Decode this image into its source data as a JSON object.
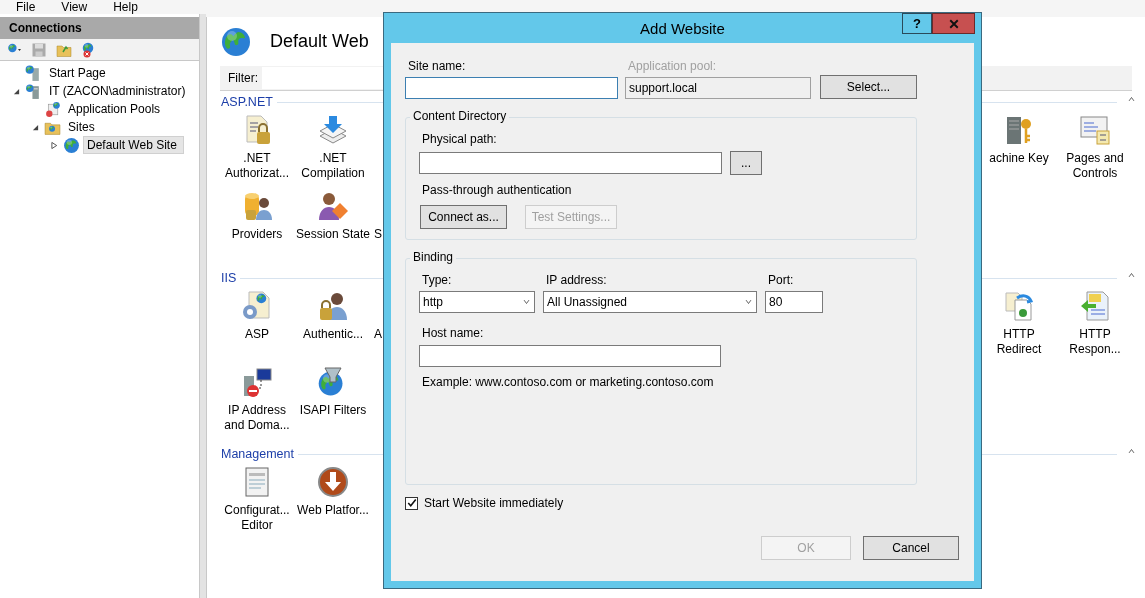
{
  "menu": [
    "File",
    "View",
    "Help"
  ],
  "connections": {
    "title": "Connections",
    "tree": [
      {
        "label": "Start Page",
        "selected": false
      },
      {
        "label": "IT (ZACON\\administrator)",
        "selected": false,
        "expanded": true,
        "children": [
          {
            "label": "Application Pools",
            "selected": false
          },
          {
            "label": "Sites",
            "selected": false,
            "expanded": true,
            "children": [
              {
                "label": "Default Web Site",
                "selected": true,
                "expanded": false
              }
            ]
          }
        ]
      }
    ]
  },
  "main": {
    "title": "Default Web",
    "filter_label": "Filter:",
    "sections": [
      {
        "title": "ASP.NET",
        "rows": [
          {
            "left": [
              {
                "label": ".NET Authorizat..."
              },
              {
                "label": ".NET Compilation"
              }
            ],
            "right": [
              {
                "label": "achine Key"
              },
              {
                "label": "Pages and Controls"
              }
            ]
          },
          {
            "left": [
              {
                "label": "Providers"
              },
              {
                "label": "Session State"
              },
              {
                "label": "S",
                "kind": "cut"
              }
            ]
          }
        ]
      },
      {
        "title": "IIS",
        "rows": [
          {
            "left": [
              {
                "label": "ASP"
              },
              {
                "label": "Authentic..."
              },
              {
                "label": "A",
                "kind": "cut"
              }
            ],
            "right": [
              {
                "label": "HTTP Redirect"
              },
              {
                "label": "HTTP Respon..."
              }
            ]
          },
          {
            "left": [
              {
                "label": "IP Address and Doma..."
              },
              {
                "label": "ISAPI Filters"
              }
            ]
          }
        ]
      },
      {
        "title": "Management",
        "rows": [
          {
            "left": [
              {
                "label": "Configurat... Editor"
              },
              {
                "label": "Web Platfor..."
              }
            ]
          }
        ]
      }
    ]
  },
  "dialog": {
    "title": "Add Website",
    "help": "?",
    "site_name": {
      "label": "Site name:",
      "focused": true
    },
    "app_pool": {
      "label": "Application pool:",
      "value": "support.local",
      "disabled": true
    },
    "select_button": "Select...",
    "content_directory": {
      "title": "Content Directory",
      "path_label": "Physical path:",
      "browse_button": "...",
      "auth_label": "Pass-through authentication",
      "buttons": [
        {
          "label": "Connect as...",
          "disabled": false
        },
        {
          "label": "Test Settings...",
          "disabled": true
        }
      ]
    },
    "binding": {
      "title": "Binding",
      "type": {
        "label": "Type:",
        "value": "http"
      },
      "ip": {
        "label": "IP address:",
        "value": "All Unassigned"
      },
      "port": {
        "label": "Port:",
        "value": "80"
      },
      "host_label": "Host name:",
      "example": "Example: www.contoso.com or marketing.contoso.com"
    },
    "start_checkbox": {
      "label": "Start Website immediately",
      "checked": true
    },
    "buttons": [
      {
        "label": "OK",
        "disabled": true
      },
      {
        "label": "Cancel",
        "disabled": false
      }
    ]
  }
}
